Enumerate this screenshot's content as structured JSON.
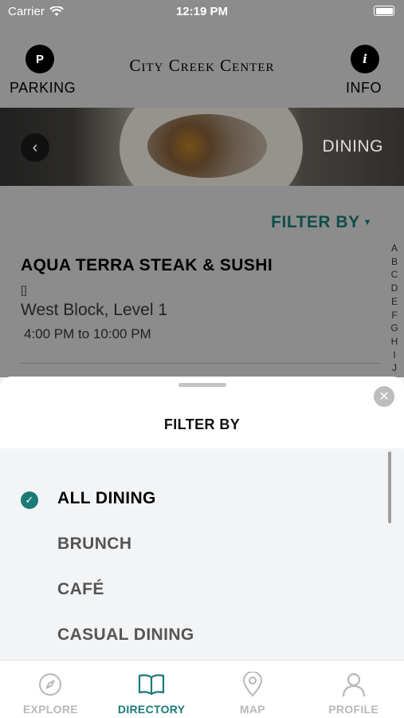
{
  "status_bar": {
    "carrier": "Carrier",
    "time": "12:19 PM"
  },
  "header": {
    "title": "City Creek Center",
    "parking_icon_letter": "P",
    "parking_label": "PARKING",
    "info_icon_letter": "i",
    "info_label": "INFO"
  },
  "banner": {
    "title": "DINING"
  },
  "directory": {
    "filter_label": "FILTER BY",
    "alphabet": [
      "A",
      "B",
      "C",
      "D",
      "E",
      "F",
      "G",
      "H",
      "I",
      "J"
    ],
    "listing": {
      "name": "AQUA TERRA STEAK & SUSHI",
      "icon_text": "[]",
      "location": "West Block, Level 1",
      "hours": "4:00 PM to 10:00 PM"
    }
  },
  "filter_sheet": {
    "title": "FILTER BY",
    "options": [
      {
        "label": "ALL DINING",
        "selected": true
      },
      {
        "label": "BRUNCH",
        "selected": false
      },
      {
        "label": "CAFÉ",
        "selected": false
      },
      {
        "label": "CASUAL DINING",
        "selected": false
      }
    ]
  },
  "tab_bar": {
    "tabs": [
      {
        "label": "EXPLORE",
        "icon": "compass-icon",
        "active": false
      },
      {
        "label": "DIRECTORY",
        "icon": "book-icon",
        "active": true
      },
      {
        "label": "MAP",
        "icon": "map-pin-icon",
        "active": false
      },
      {
        "label": "PROFILE",
        "icon": "person-icon",
        "active": false
      }
    ]
  },
  "colors": {
    "accent": "#1a7a78",
    "filter_text": "#0f4d4a",
    "overlay": "#8c8c8c"
  }
}
